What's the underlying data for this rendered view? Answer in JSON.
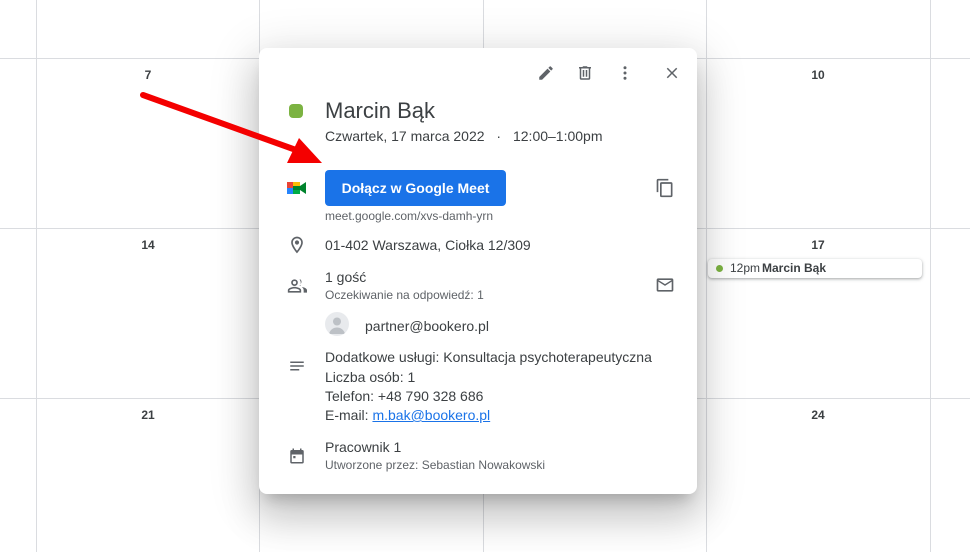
{
  "calendar": {
    "days": [
      {
        "label": "7"
      },
      {
        "label": "10"
      },
      {
        "label": "14"
      },
      {
        "label": "17"
      },
      {
        "label": "21"
      },
      {
        "label": "24"
      }
    ],
    "event": {
      "time": "12pm",
      "title": "Marcin Bąk",
      "color": "#7cb342"
    }
  },
  "popup": {
    "toolbar": {
      "edit_icon": "pencil-icon",
      "delete_icon": "trash-icon",
      "more_icon": "more-vert-icon",
      "close_icon": "close-icon"
    },
    "event_color": "#7cb342",
    "title": "Marcin Bąk",
    "date": "Czwartek, 17 marca 2022",
    "separator": "·",
    "time_range": "12:00–1:00pm",
    "meet": {
      "button_label": "Dołącz w Google Meet",
      "link_text": "meet.google.com/xvs-damh-yrn",
      "button_color": "#1a73e8"
    },
    "location": "01-402 Warszawa, Ciołka 12/309",
    "guests": {
      "count_label": "1 gość",
      "status": "Oczekiwanie na odpowiedź: 1",
      "list": [
        {
          "email": "partner@bookero.pl"
        }
      ]
    },
    "description": {
      "line1": "Dodatkowe usługi: Konsultacja psychoterapeutyczna",
      "line2": "Liczba osób: 1",
      "line3": "Telefon: +48 790 328 686",
      "email_prefix": "E-mail: ",
      "email": "m.bak@bookero.pl"
    },
    "calendar_info": {
      "name": "Pracownik 1",
      "created_by": "Utworzone przez: Sebastian Nowakowski"
    }
  },
  "annotation": {
    "arrow_color": "#f40000"
  }
}
